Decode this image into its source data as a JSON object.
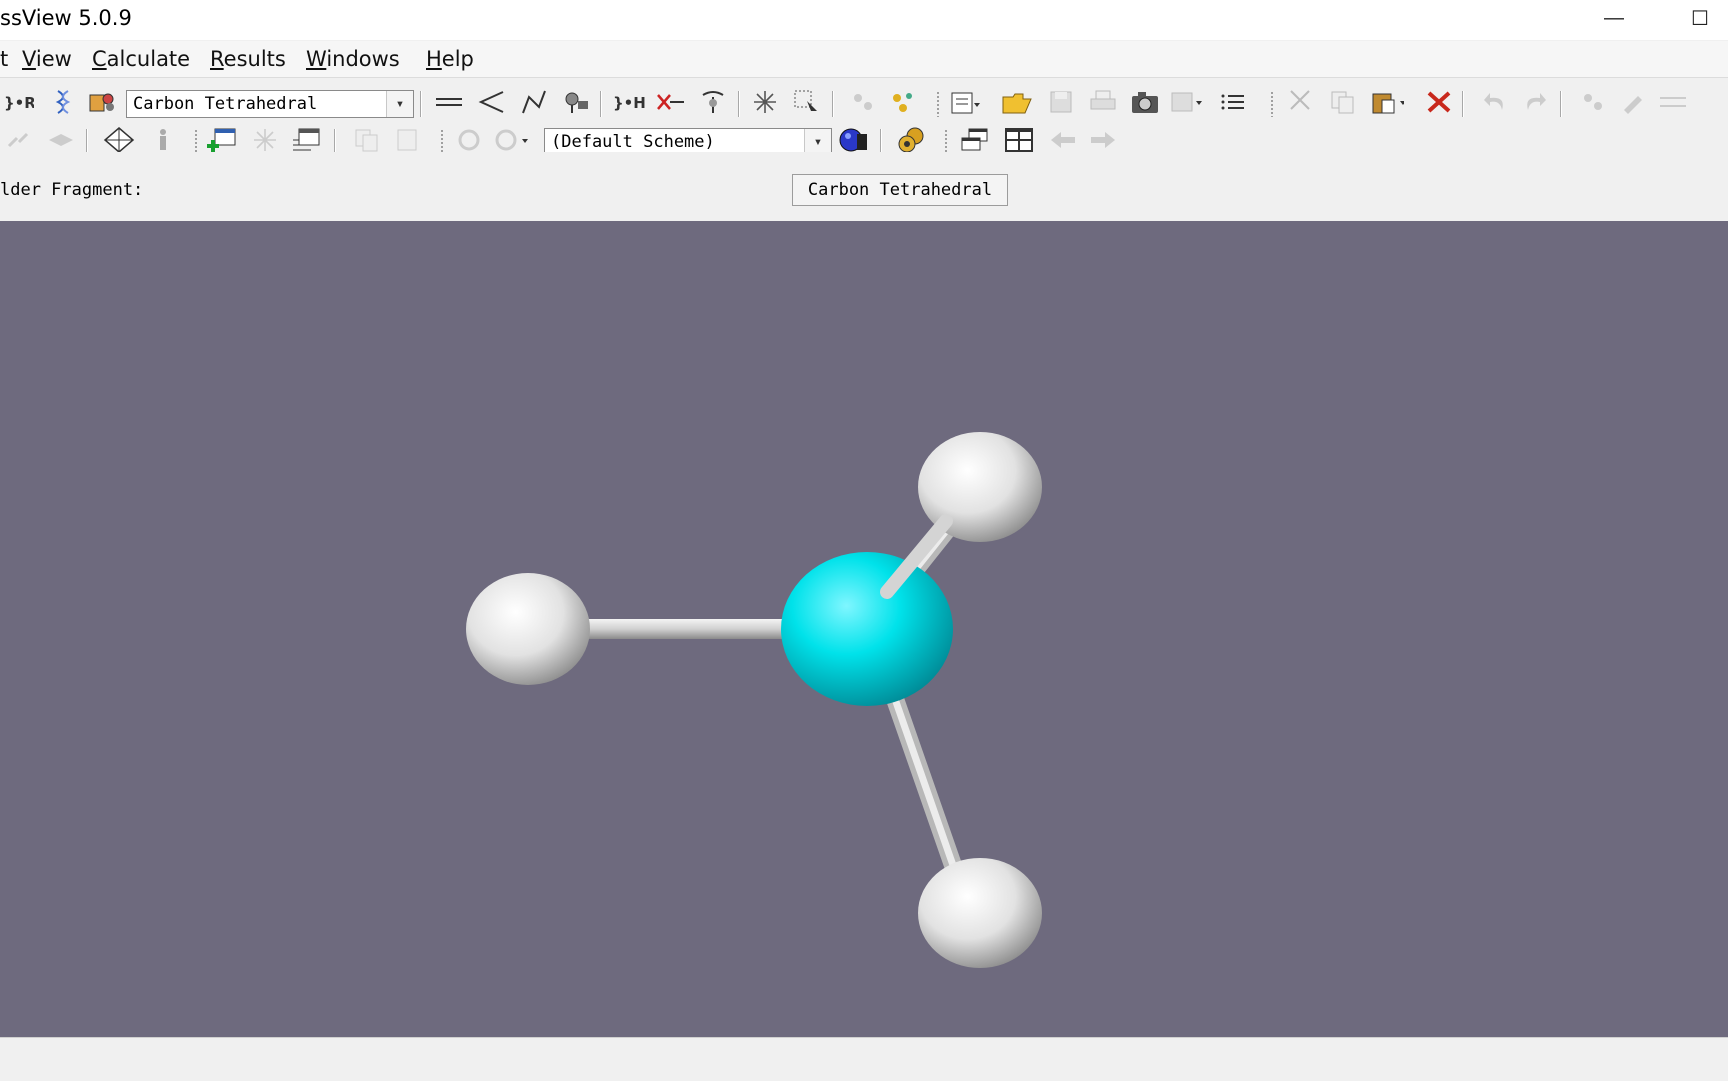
{
  "window": {
    "title": "ssView 5.0.9",
    "minimize_glyph": "—",
    "maximize_glyph": "☐"
  },
  "menu": [
    "t",
    "View",
    "Calculate",
    "Results",
    "Windows",
    "Help"
  ],
  "toolbar1": {
    "fragment_combo": "Carbon Tetrahedral"
  },
  "toolbar2": {
    "scheme_combo": "(Default Scheme)"
  },
  "builder": {
    "label": "lder Fragment:",
    "fragment_display": "Carbon Tetrahedral"
  },
  "molecule": {
    "central_atom_color": "#00e5ea",
    "hydrogen_color": "#f2f2f2",
    "bond_color": "#d8d8d8",
    "background_color": "#6e6a7e"
  },
  "icons": {
    "combo_arrow": "▾"
  }
}
